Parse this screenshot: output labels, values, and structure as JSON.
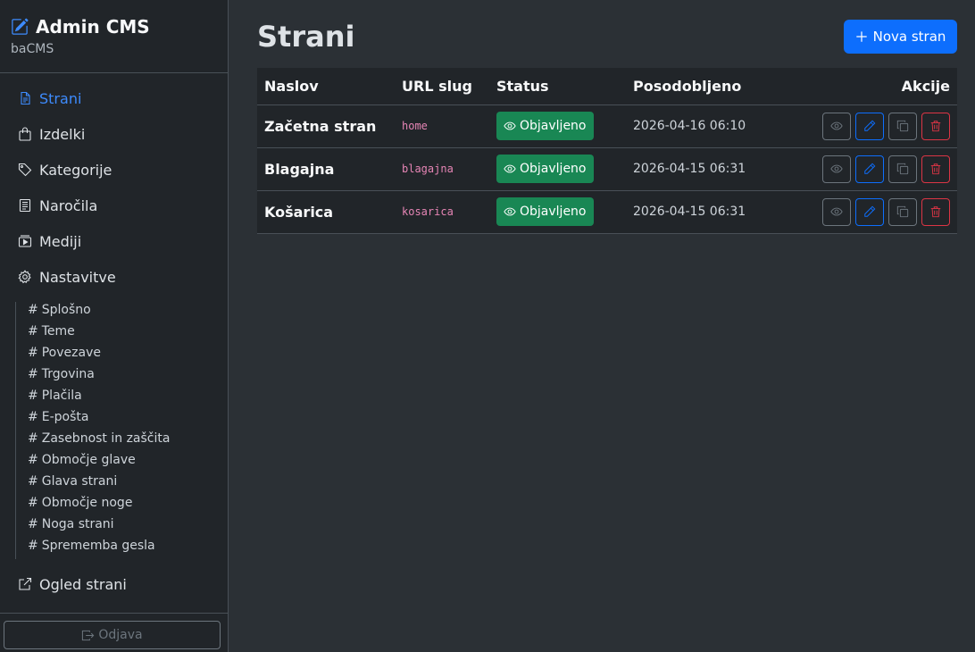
{
  "brand": {
    "title": "Admin CMS",
    "subtitle": "baCMS"
  },
  "nav": {
    "items": [
      {
        "label": "Strani"
      },
      {
        "label": "Izdelki"
      },
      {
        "label": "Kategorije"
      },
      {
        "label": "Naročila"
      },
      {
        "label": "Mediji"
      },
      {
        "label": "Nastavitve"
      }
    ],
    "settings_sub": [
      "Splošno",
      "Teme",
      "Povezave",
      "Trgovina",
      "Plačila",
      "E-pošta",
      "Zasebnost in zaščita",
      "Območje glave",
      "Glava strani",
      "Območje noge",
      "Noga strani",
      "Sprememba gesla"
    ],
    "view_site": "Ogled strani",
    "logout": "Odjava"
  },
  "page": {
    "title": "Strani",
    "new_button": "Nova stran"
  },
  "table": {
    "headers": [
      "Naslov",
      "URL slug",
      "Status",
      "Posodobljeno",
      "Akcije"
    ],
    "rows": [
      {
        "title": "Začetna stran",
        "slug": "home",
        "status": "Objavljeno",
        "updated": "2026-04-16 06:10"
      },
      {
        "title": "Blagajna",
        "slug": "blagajna",
        "status": "Objavljeno",
        "updated": "2026-04-15 06:31"
      },
      {
        "title": "Košarica",
        "slug": "kosarica",
        "status": "Objavljeno",
        "updated": "2026-04-15 06:31"
      }
    ]
  },
  "colors": {
    "accent": "#0d6efd",
    "active_link": "#3d8bfd",
    "success": "#198754",
    "danger": "#dc3545",
    "slug": "#e685b5"
  },
  "icons": {
    "brand": "pencil-square-icon",
    "nav": [
      "file-text-icon",
      "bag-icon",
      "tags-icon",
      "receipt-icon",
      "media-icon",
      "gear-icon"
    ],
    "view_site": "external-link-icon",
    "logout": "box-arrow-right-icon",
    "row_actions": [
      "eye-icon",
      "pencil-icon",
      "copy-icon",
      "trash-icon"
    ]
  }
}
